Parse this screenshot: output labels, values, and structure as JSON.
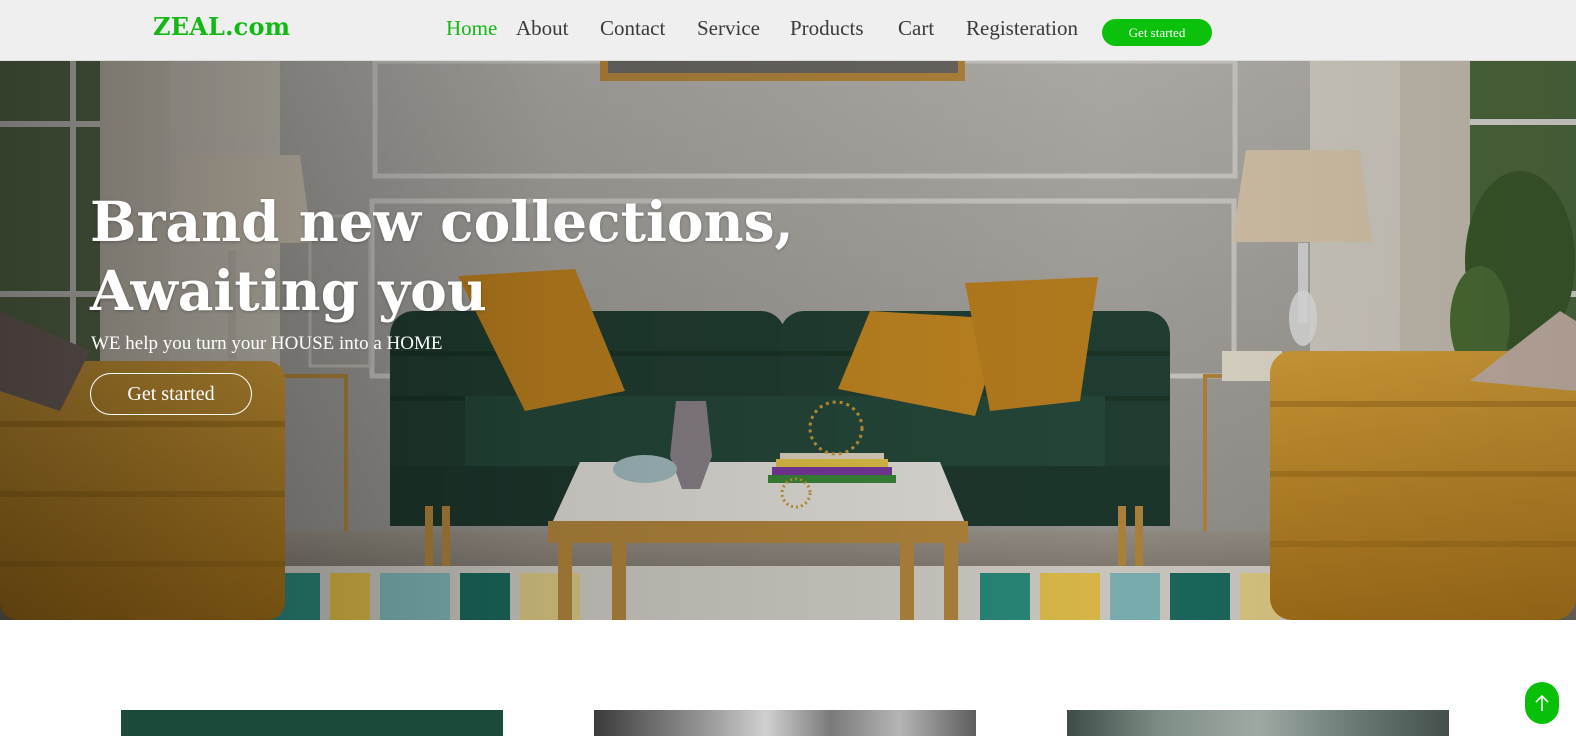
{
  "brand": {
    "name": "ZEAL.com",
    "color": "#14b814"
  },
  "nav": {
    "items": [
      {
        "label": "Home",
        "active": true
      },
      {
        "label": "About",
        "active": false
      },
      {
        "label": "Contact",
        "active": false
      },
      {
        "label": "Service",
        "active": false
      },
      {
        "label": "Products",
        "active": false
      },
      {
        "label": "Cart",
        "active": false
      },
      {
        "label": "Registeration",
        "active": false
      }
    ],
    "cta_label": "Get started",
    "accent": "#0cc10c"
  },
  "hero": {
    "title_line1": "Brand new collections,",
    "title_line2": "Awaiting you",
    "subtitle": "WE help you turn your HOUSE into a HOME",
    "button_label": "Get started"
  },
  "cards": [
    {
      "name": "collection-card-1"
    },
    {
      "name": "collection-card-2"
    },
    {
      "name": "collection-card-3"
    }
  ],
  "scroll_top": {
    "icon": "arrow-up-icon"
  }
}
